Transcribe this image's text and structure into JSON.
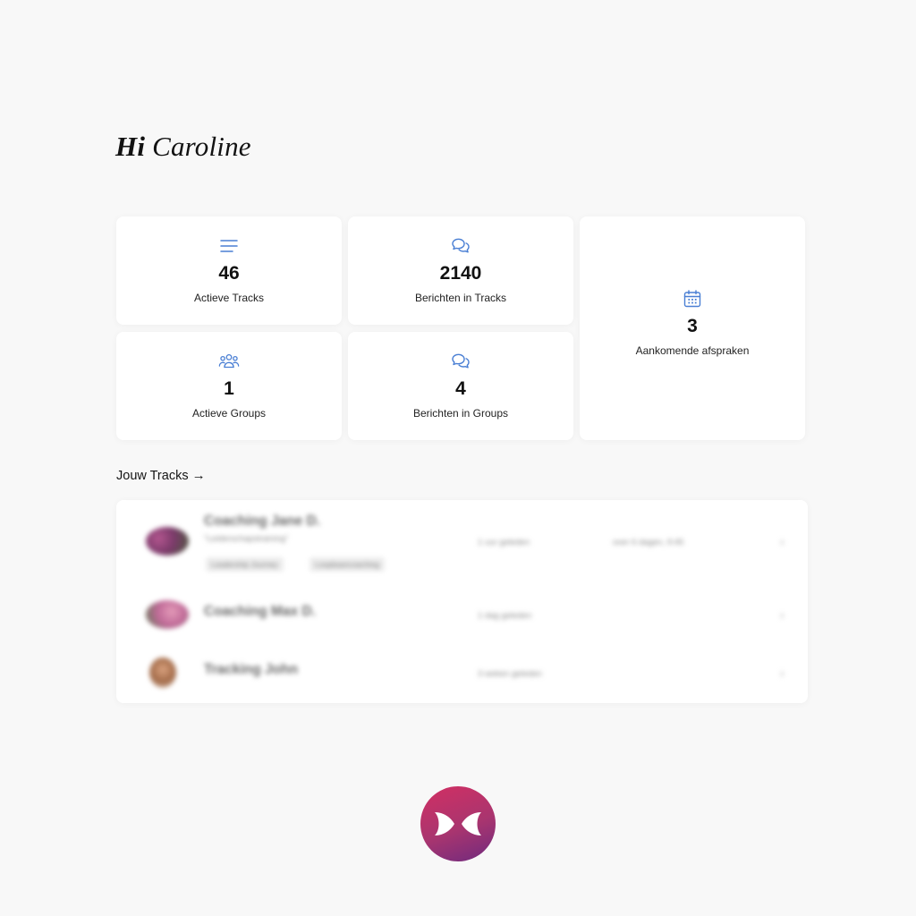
{
  "greeting": {
    "hi": "Hi",
    "name": "Caroline"
  },
  "stats": [
    {
      "icon": "list-icon",
      "value": "46",
      "label": "Actieve Tracks"
    },
    {
      "icon": "chat-icon",
      "value": "2140",
      "label": "Berichten in Tracks"
    },
    {
      "icon": "group-icon",
      "value": "1",
      "label": "Actieve Groups"
    },
    {
      "icon": "chat-icon",
      "value": "4",
      "label": "Berichten in Groups"
    },
    {
      "icon": "calendar-icon",
      "value": "3",
      "label": "Aankomende afspraken"
    }
  ],
  "tracks_section": {
    "title": "Jouw Tracks",
    "arrow": "→"
  },
  "tracks": [
    {
      "name": "Coaching Jane D.",
      "subtitle": "\"Leiderschapstraining\"",
      "tags": [
        "Leadership Journey",
        "Loopbaancoaching"
      ],
      "last_message": "1 uur geleden",
      "next_meeting": "over 6 dagen, 9:45"
    },
    {
      "name": "Coaching Max D.",
      "last_message": "1 dag geleden"
    },
    {
      "name": "Tracking John",
      "last_message": "3 weken geleden"
    }
  ],
  "colors": {
    "accent": "#4a7fd4",
    "background": "#f8f8f8",
    "card": "#ffffff",
    "logo_start": "#d22f63",
    "logo_end": "#6f2a7e"
  }
}
